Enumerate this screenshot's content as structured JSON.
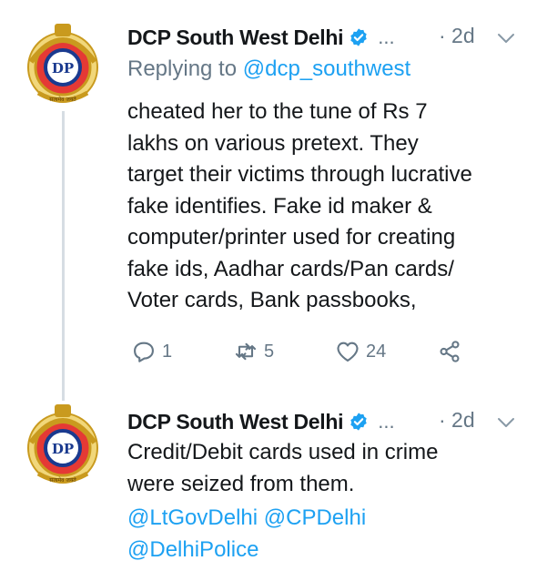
{
  "tweets": [
    {
      "author": "DCP South West Delhi",
      "more": "...",
      "time": "· 2d",
      "reply_prefix": "Replying to",
      "reply_handle": "@dcp_southwest",
      "text": "cheated her to the tune of Rs 7\nlakhs on various pretext. They\ntarget their victims through lucrative\nfake identifies. Fake id maker &\ncomputer/printer used for creating\nfake ids, Aadhar cards/Pan cards/\nVoter cards, Bank passbooks,",
      "counts": {
        "replies": "1",
        "retweets": "5",
        "likes": "24"
      }
    },
    {
      "author": "DCP South West Delhi",
      "more": "...",
      "time": "· 2d",
      "text": "Credit/Debit cards used in crime\nwere seized from them.",
      "mentions": "@LtGovDelhi @CPDelhi\n@DelhiPolice"
    }
  ],
  "avatar_text": "सत्यमेव जयते",
  "avatar_monogram": "DP",
  "icons": {
    "verified": "verified-badge-icon",
    "chevron": "chevron-down-icon",
    "reply": "reply-icon",
    "retweet": "retweet-icon",
    "like": "heart-icon",
    "share": "share-icon"
  },
  "colors": {
    "accent": "#1da1f2",
    "muted": "#657786",
    "text": "#14171a"
  }
}
